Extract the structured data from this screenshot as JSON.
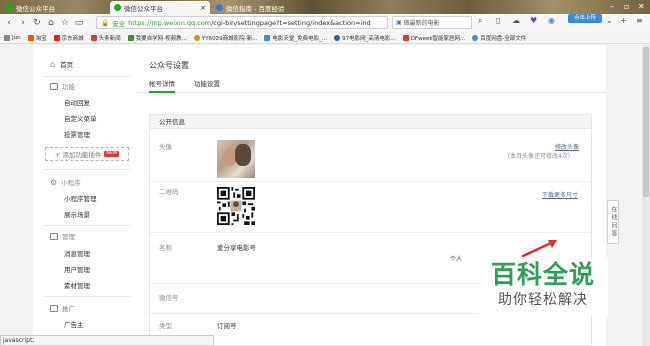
{
  "browser": {
    "tabs": [
      {
        "label": "微信公众平台"
      },
      {
        "label": "微信公众平台"
      },
      {
        "label": "微信指南 - 百度经验"
      }
    ],
    "login_label": "点击上传",
    "address": {
      "secure_label": "安全",
      "url_host": "https://mp.weixin.qq.com",
      "url_path": "/cgi-bin/settingpage?t=setting/index&action=ind"
    },
    "search_text": "做最新的电影",
    "bookmarks": [
      "Jun",
      "淘宝",
      "京东商城",
      "头条新闻",
      "我要自学网-视频教...",
      "YY6029商城影院-新...",
      "电影天堂_免费电影_...",
      "97电影网_高清电影...",
      "OFweek智能家居网...",
      "百度网盘-全部文件"
    ],
    "status_text": "javascript;"
  },
  "sidebar": {
    "home": "首页",
    "sections": [
      {
        "title": "功能",
        "items": [
          "自动回复",
          "自定义菜单",
          "投票管理"
        ]
      },
      {
        "title": "小程序",
        "items": [
          "小程序管理",
          "展示场景"
        ]
      },
      {
        "title": "管理",
        "items": [
          "消息管理",
          "用户管理",
          "素材管理"
        ]
      },
      {
        "title": "推广",
        "items": [
          "广告主"
        ]
      }
    ],
    "add_plugin": "+ 添加功能插件",
    "new_badge": "NEW"
  },
  "main": {
    "title": "公众号设置",
    "tabs": [
      "帐号详情",
      "功能设置"
    ],
    "card_title": "公开信息",
    "rows": {
      "avatar": {
        "label": "头像",
        "action": "修改头像",
        "hint": "（本月头像还可修改4次）"
      },
      "qrcode": {
        "label": "二维码",
        "action": "下载更多尺寸"
      },
      "name": {
        "label": "名称",
        "value": "爱分享电影号",
        "note": "个人"
      },
      "wechat_id": {
        "label": "微信号"
      },
      "type": {
        "label": "类型",
        "value": "订阅号"
      }
    }
  },
  "float_tab": "在线问答",
  "watermark": {
    "title": "百科全说",
    "subtitle": "助你轻松解决"
  },
  "colors": {
    "accent": "#1aad19",
    "link": "#576b95",
    "watermark": "#2f9f55"
  }
}
